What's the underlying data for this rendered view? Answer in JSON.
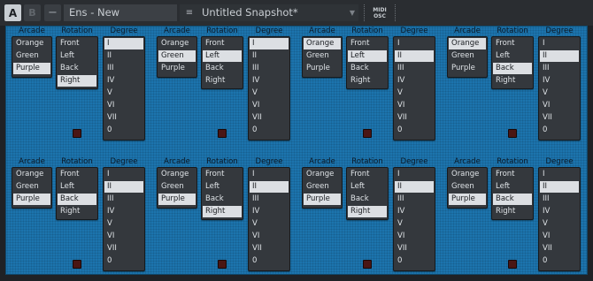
{
  "toolbar": {
    "a_label": "A",
    "b_label": "B",
    "minus_label": "−",
    "ensemble_name": "Ens - New",
    "snapshot_title": "Untitled Snapshot*",
    "midi_line1": "MIDI",
    "midi_line2": "OSC"
  },
  "headers": {
    "arcade": "Arcade",
    "rotation": "Rotation",
    "degree": "Degree"
  },
  "arcade_options": [
    "Orange",
    "Green",
    "Purple"
  ],
  "rotation_options": [
    "Front",
    "Left",
    "Back",
    "Right"
  ],
  "degree_options": [
    "I",
    "II",
    "III",
    "IV",
    "V",
    "VI",
    "VII",
    "0"
  ],
  "modules": [
    {
      "arcade": "Purple",
      "rotation": "Right",
      "degree": "I"
    },
    {
      "arcade": "Green",
      "rotation": "Left",
      "degree": "I"
    },
    {
      "arcade": "Orange",
      "rotation": "Left",
      "degree": "II"
    },
    {
      "arcade": "Orange",
      "rotation": "Back",
      "degree": "II"
    },
    {
      "arcade": "Purple",
      "rotation": "Back",
      "degree": "II"
    },
    {
      "arcade": "Purple",
      "rotation": "Right",
      "degree": "II"
    },
    {
      "arcade": "Purple",
      "rotation": "Right",
      "degree": "II"
    },
    {
      "arcade": "Purple",
      "rotation": "Back",
      "degree": "II"
    }
  ]
}
